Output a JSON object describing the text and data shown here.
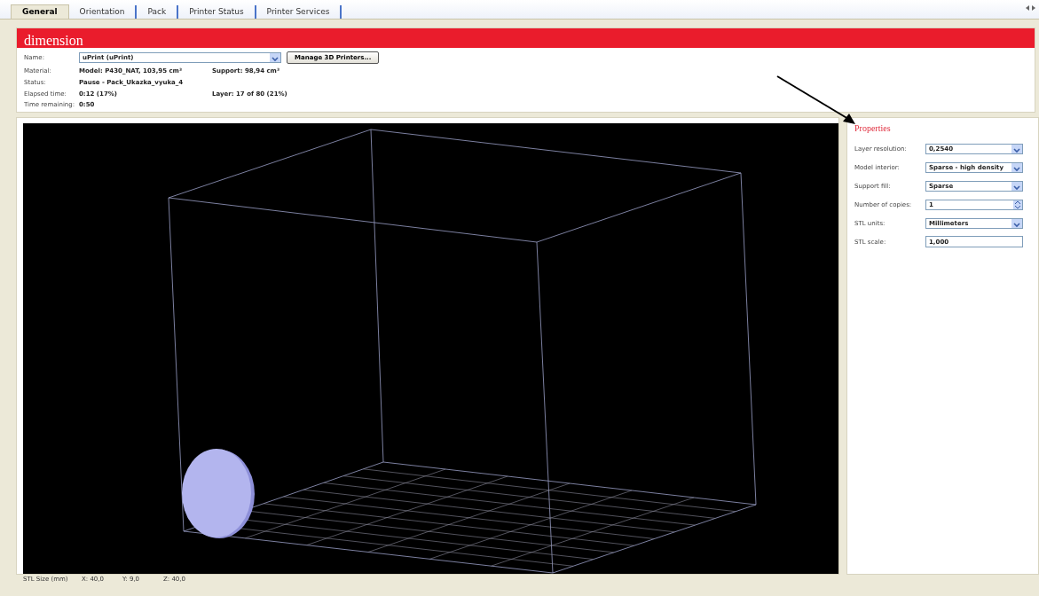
{
  "tabs": [
    {
      "label": "General",
      "selected": true
    },
    {
      "label": "Orientation",
      "selected": false
    },
    {
      "label": "Pack",
      "selected": false
    },
    {
      "label": "Printer Status",
      "selected": false
    },
    {
      "label": "Printer Services",
      "selected": false
    }
  ],
  "brand": "dimension",
  "printer": {
    "label": "Name:",
    "value": "uPrint  (uPrint)",
    "button": "Manage 3D Printers..."
  },
  "info_rows": [
    {
      "label": "Material:",
      "value": "Model: P430_NAT, 103,95 cm³",
      "extra": "Support: 98,94 cm³"
    },
    {
      "label": "Status:",
      "value": "Pause - Pack_Ukazka_vyuka_4"
    },
    {
      "label": "Elapsed time:",
      "value": "0:12  (17%)",
      "extra": "Layer: 17 of 80  (21%)"
    },
    {
      "label": "Time remaining:",
      "value": "0:50"
    }
  ],
  "properties": {
    "title": "Properties",
    "fields": [
      {
        "label": "Layer resolution:",
        "value": "0,2540",
        "kind": "dropdown"
      },
      {
        "label": "Model interior:",
        "value": "Sparse - high density",
        "kind": "dropdown"
      },
      {
        "label": "Support fill:",
        "value": "Sparse",
        "kind": "dropdown"
      },
      {
        "label": "Number of copies:",
        "value": "1",
        "kind": "spinner"
      },
      {
        "label": "STL units:",
        "value": "Millimeters",
        "kind": "dropdown"
      },
      {
        "label": "STL scale:",
        "value": "1,000",
        "kind": "text"
      }
    ]
  },
  "stl_size": {
    "label": "STL Size (mm)",
    "values": [
      "X: 40,0",
      "Y: 9,0",
      "Z: 40,0"
    ]
  }
}
